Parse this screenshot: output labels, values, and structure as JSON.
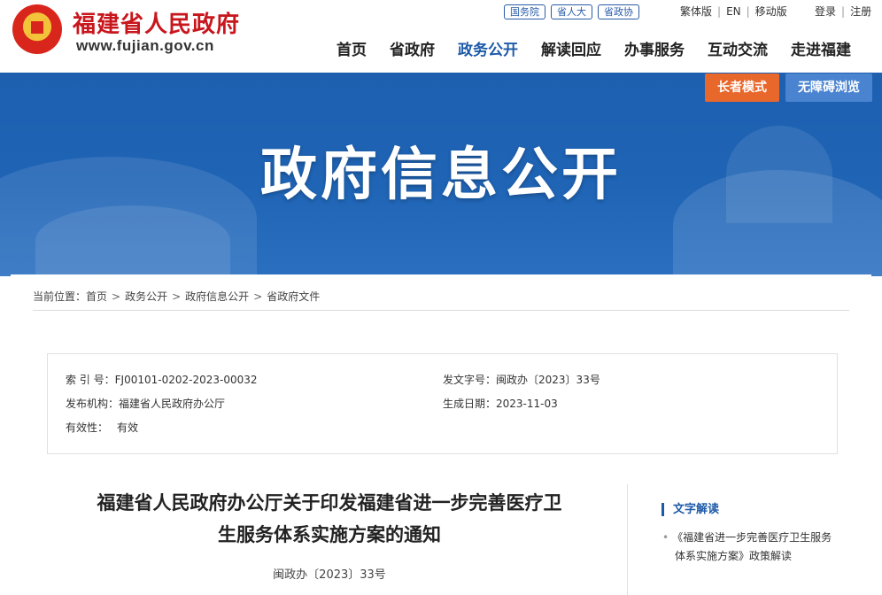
{
  "header": {
    "site_name": "福建省人民政府",
    "site_url": "www.fujian.gov.cn",
    "top_links": [
      "国务院",
      "省人大",
      "省政协"
    ],
    "lang_links": [
      "繁体版",
      "EN",
      "移动版"
    ],
    "account_links": [
      "登录",
      "注册"
    ],
    "nav": [
      "首页",
      "省政府",
      "政务公开",
      "解读回应",
      "办事服务",
      "互动交流",
      "走进福建"
    ],
    "active_nav": "政务公开"
  },
  "banner": {
    "title": "政府信息公开",
    "elder_mode": "长者模式",
    "accessibility": "无障碍浏览"
  },
  "breadcrumb": {
    "label": "当前位置：",
    "items": [
      "首页",
      "政务公开",
      "政府信息公开",
      "省政府文件"
    ]
  },
  "meta": {
    "index_label": "索 引 号：",
    "index_value": "FJ00101-0202-2023-00032",
    "doc_no_label": "发文字号：",
    "doc_no_value": "闽政办〔2023〕33号",
    "publisher_label": "发布机构：",
    "publisher_value": "福建省人民政府办公厅",
    "date_label": "生成日期：",
    "date_value": "2023-11-03",
    "validity_label": "有效性：",
    "validity_value": "有效"
  },
  "document": {
    "title_line1": "福建省人民政府办公厅关于印发福建省进一步完善医疗卫",
    "title_line2": "生服务体系实施方案的通知",
    "number": "闽政办〔2023〕33号"
  },
  "sidebar": {
    "heading": "文字解读",
    "link_line1": "《福建省进一步完善医疗卫生服务",
    "link_line2": "体系实施方案》政策解读"
  },
  "colors": {
    "brand_red": "#c8161d",
    "nav_blue": "#1d5aa8",
    "banner_blue": "#1f64b5",
    "elder_orange": "#e8672b"
  }
}
